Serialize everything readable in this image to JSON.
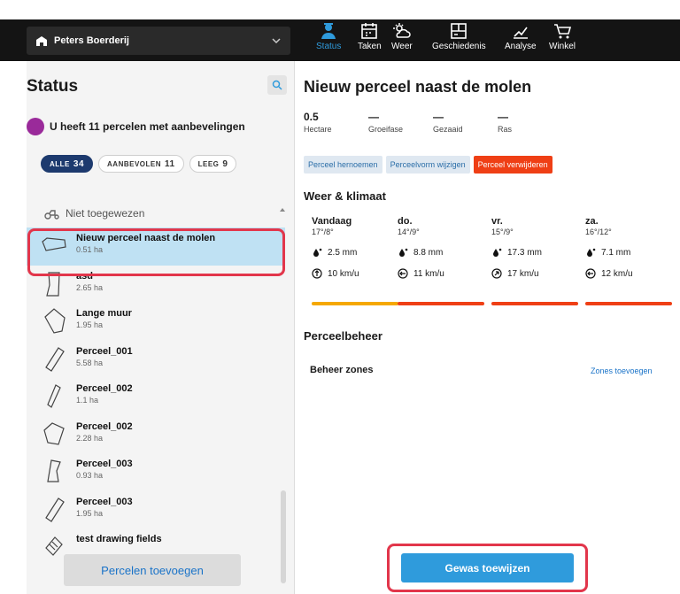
{
  "header": {
    "farm_name": "Peters Boerderij",
    "nav": [
      {
        "label": "Status",
        "icon": "farmer-icon",
        "active": true
      },
      {
        "label": "Taken",
        "icon": "calendar-icon",
        "active": false
      },
      {
        "label": "Weer",
        "icon": "weather-icon",
        "active": false
      },
      {
        "label": "Geschiedenis",
        "icon": "history-icon",
        "active": false
      },
      {
        "label": "Analyse",
        "icon": "analysis-icon",
        "active": false
      },
      {
        "label": "Winkel",
        "icon": "cart-icon",
        "active": false
      }
    ]
  },
  "sidebar": {
    "title": "Status",
    "recommendation": "U heeft 11 percelen met aanbevelingen",
    "filters": [
      {
        "label": "ALLE",
        "count": "34",
        "active": true
      },
      {
        "label": "AANBEVOLEN",
        "count": "11",
        "active": false
      },
      {
        "label": "LEEG",
        "count": "9",
        "active": false
      }
    ],
    "group_label": "Niet toegewezen",
    "fields": [
      {
        "name": "Nieuw perceel naast de molen",
        "area": "0.51 ha",
        "selected": true
      },
      {
        "name": "asd",
        "area": "2.65 ha"
      },
      {
        "name": "Lange muur",
        "area": "1.95 ha"
      },
      {
        "name": "Perceel_001",
        "area": "5.58 ha"
      },
      {
        "name": "Perceel_002",
        "area": "1.1 ha"
      },
      {
        "name": "Perceel_002",
        "area": "2.28 ha"
      },
      {
        "name": "Perceel_003",
        "area": "0.93 ha"
      },
      {
        "name": "Perceel_003",
        "area": "1.95 ha"
      },
      {
        "name": "test drawing fields",
        "area": ""
      }
    ],
    "add_button": "Percelen toevoegen"
  },
  "main": {
    "title": "Nieuw perceel naast de molen",
    "facts": [
      {
        "value": "0.5",
        "label": "Hectare"
      },
      {
        "value": "—",
        "label": "Groeifase"
      },
      {
        "value": "—",
        "label": "Gezaaid"
      },
      {
        "value": "—",
        "label": "Ras"
      }
    ],
    "actions": {
      "rename": "Perceel hernoemen",
      "reshape": "Perceelvorm wijzigen",
      "delete": "Perceel verwijderen"
    },
    "weather_title": "Weer & klimaat",
    "weather": [
      {
        "day": "Vandaag",
        "temp": "17°/8°",
        "rain": "2.5 mm",
        "wind": "10 km/u",
        "bar_color": "#f5a800"
      },
      {
        "day": "do.",
        "temp": "14°/9°",
        "rain": "8.8 mm",
        "wind": "11 km/u",
        "bar_color": "#ef3f15"
      },
      {
        "day": "vr.",
        "temp": "15°/9°",
        "rain": "17.3 mm",
        "wind": "17 km/u",
        "bar_color": "#ef3f15"
      },
      {
        "day": "za.",
        "temp": "16°/12°",
        "rain": "7.1 mm",
        "wind": "12 km/u",
        "bar_color": "#ef3f15"
      }
    ],
    "management_title": "Perceelbeheer",
    "management_zones": "Beheer zones",
    "add_zones": "Zones toevoegen",
    "assign_button": "Gewas toewijzen"
  },
  "colors": {
    "accent": "#2f9bdc",
    "danger": "#ef3f15",
    "highlight": "#e2364b",
    "selected": "#bfe1f3"
  }
}
